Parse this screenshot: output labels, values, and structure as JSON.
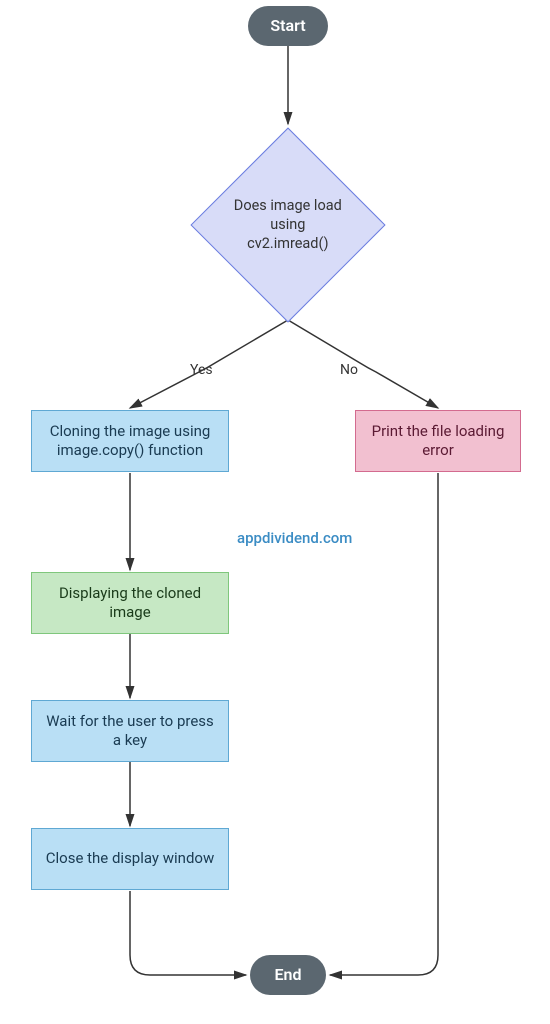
{
  "nodes": {
    "start": "Start",
    "decision": "Does image load using cv2.imread()",
    "yes": "Yes",
    "no": "No",
    "clone": "Cloning the image using image.copy() function",
    "error": "Print the file loading error",
    "display": "Displaying the cloned image",
    "wait": "Wait for the user to press a key",
    "close": "Close the display window",
    "end": "End"
  },
  "watermark": "appdividend.com"
}
